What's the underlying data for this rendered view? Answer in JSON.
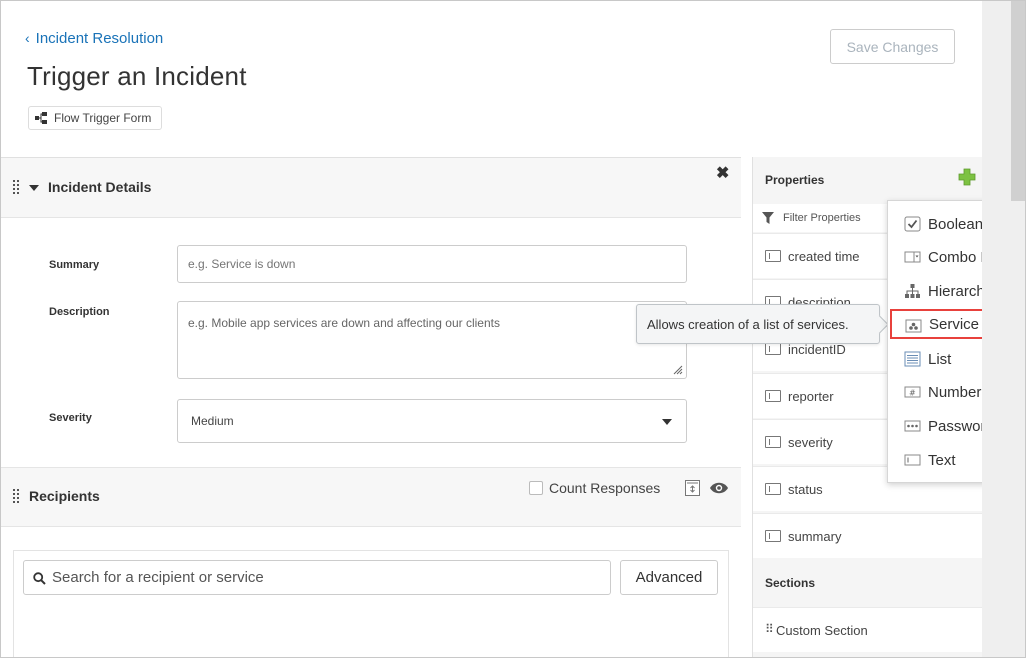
{
  "header": {
    "back_link": "Incident Resolution",
    "title": "Trigger an Incident",
    "flow_badge": "Flow Trigger Form",
    "save_button": "Save Changes"
  },
  "incident_details": {
    "title": "Incident Details",
    "fields": {
      "summary": {
        "label": "Summary",
        "placeholder": "e.g. Service is down",
        "value": ""
      },
      "description": {
        "label": "Description",
        "placeholder": "e.g. Mobile app services are down and affecting our clients",
        "value": ""
      },
      "severity": {
        "label": "Severity",
        "value": "Medium"
      }
    }
  },
  "recipients": {
    "title": "Recipients",
    "count_responses": "Count Responses",
    "count_responses_checked": false,
    "search_placeholder": "Search for a recipient or service",
    "advanced_button": "Advanced"
  },
  "properties": {
    "title": "Properties",
    "filter_placeholder": "Filter Properties",
    "items": [
      "created time",
      "description",
      "incidentID",
      "reporter",
      "severity",
      "status",
      "summary"
    ],
    "sections_title": "Sections",
    "sections": [
      "Custom Section"
    ]
  },
  "type_menu": {
    "items": [
      "Boolean",
      "Combo Box",
      "Hierarchy",
      "Service",
      "List",
      "Number",
      "Password",
      "Text"
    ],
    "highlighted": "Service"
  },
  "tooltip": "Allows creation of a list of services.",
  "colors": {
    "link": "#1a73b8",
    "accent_green": "#7dc242",
    "highlight_border": "#e8413c",
    "panel_bg": "#f5f5f5"
  }
}
